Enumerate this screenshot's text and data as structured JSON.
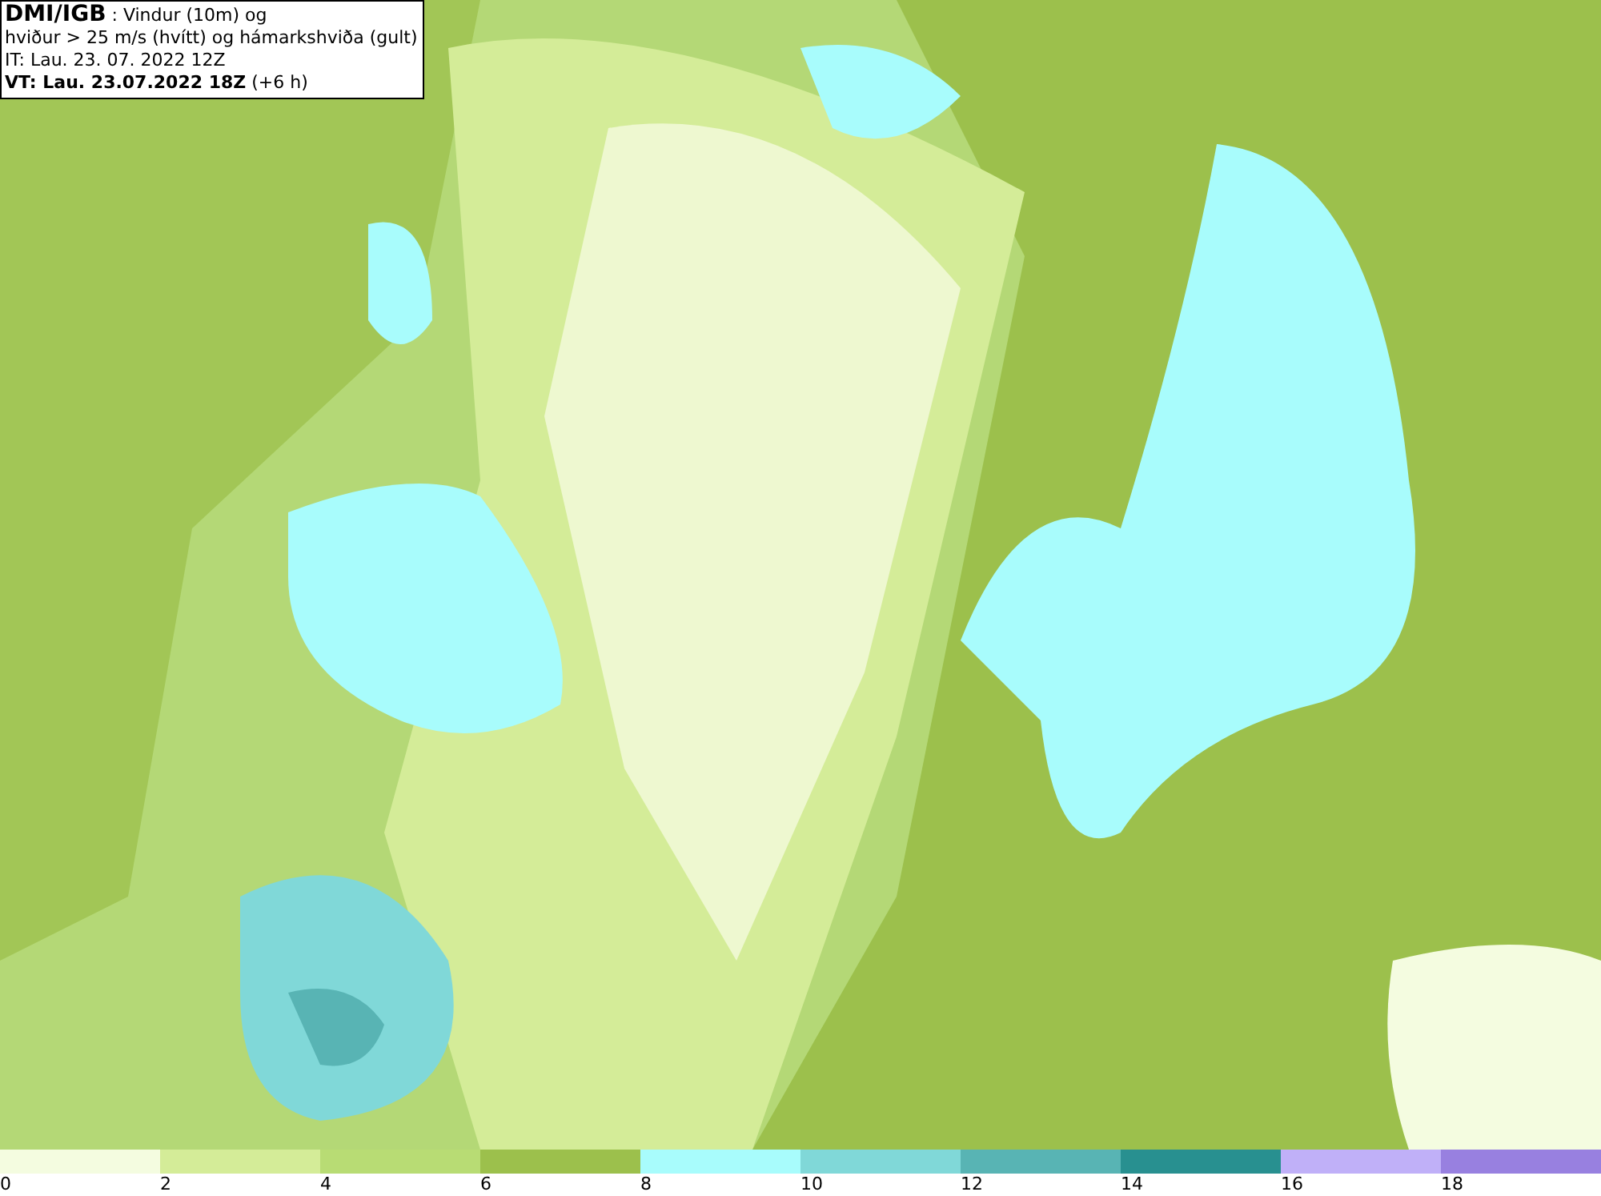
{
  "info_box": {
    "lines": [
      "**DMI/IGB** : Vindur (10m) og",
      "hviður > 25 m/s (hvítt) og hámarkshviða (gult)",
      "IT: Lau. 23. 07. 2022 12Z",
      "**VT: Lau. 23.07.2022 18Z** (+6 h)"
    ]
  },
  "legend": {
    "bins": [
      {
        "label": "0",
        "color": "#f4fce0"
      },
      {
        "label": "2",
        "color": "#d4ec98"
      },
      {
        "label": "4",
        "color": "#b8dc74"
      },
      {
        "label": "6",
        "color": "#9cc04c"
      },
      {
        "label": "8",
        "color": "#a8fcfc"
      },
      {
        "label": "10",
        "color": "#80d8d8"
      },
      {
        "label": "12",
        "color": "#58b4b4"
      },
      {
        "label": "14",
        "color": "#289090"
      },
      {
        "label": "16",
        "color": "#c0b0f8"
      },
      {
        "label": "18",
        "color": "#9880e0"
      }
    ]
  }
}
